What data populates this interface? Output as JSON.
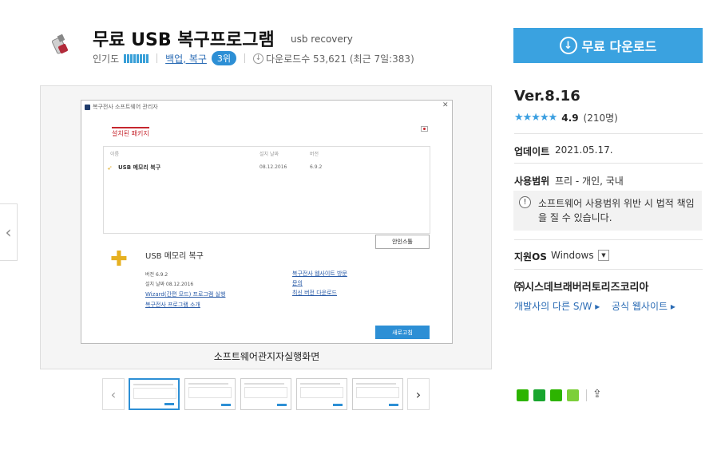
{
  "header": {
    "title": "무료 USB 복구프로그램",
    "subtitle": "usb recovery",
    "popularity_label": "인기도",
    "popularity_level": 8,
    "popularity_max": 8,
    "category": "백업, 복구",
    "rank": "3위",
    "downloads_label": "다운로드수 53,621 (최근 7일:383)"
  },
  "download_button": {
    "label": "무료 다운로드"
  },
  "screenshot": {
    "caption": "소프트웨어관지자실행화면",
    "window": {
      "title": "복구전사 소프트웨어 관리자",
      "tab": "설치된 패키지",
      "columns": [
        "이름",
        "설치 날짜",
        "버전"
      ],
      "row": {
        "name": "USB 메모리 복구",
        "date": "08.12.2016",
        "version": "6.9.2"
      },
      "remove_button": "안인스톨",
      "app_name": "USB 메모리 복구",
      "version_line": "버전 6.9.2",
      "install_line": "설치 날짜 08.12.2016",
      "link_wizard": "Wizard(간편 모드) 프로그램 실행",
      "link_intro": "복구전사 프로그램 소개",
      "link_site": "복구전사 웹사이트 방문",
      "link_contact": "문의",
      "link_latest": "최신 버전 다운로드",
      "refresh_button": "새로고침"
    }
  },
  "thumbnails": {
    "count": 5,
    "active_index": 0
  },
  "info": {
    "version": "Ver.8.16",
    "stars": "★★★★★",
    "rating": "4.9",
    "rating_count": "(210명)",
    "update_label": "업데이트",
    "update_value": "2021.05.17.",
    "scope_label": "사용범위",
    "scope_value": "프리 - 개인, 국내",
    "warning": "소프트웨어 사용범위 위반 시 법적 책임을 질 수 있습니다.",
    "os_label": "지원OS",
    "os_value": "Windows",
    "developer": "㈜시스데브래버러토리즈코리아",
    "dev_link_other": "개발사의 다른 S/W",
    "dev_link_site": "공식 웹사이트"
  },
  "colors": {
    "accent": "#3aa2e0",
    "badge": "#2d8fd5",
    "tab_red": "#c6262e"
  }
}
